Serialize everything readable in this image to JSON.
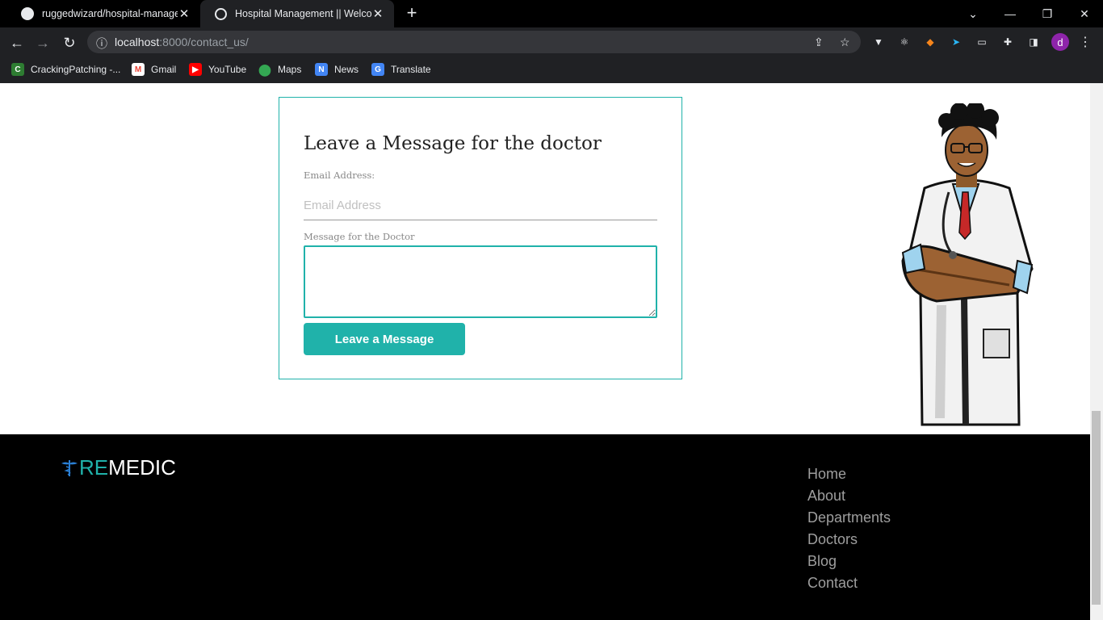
{
  "browser": {
    "tabs": [
      {
        "title": "ruggedwizard/hospital-managem",
        "close": "✕"
      },
      {
        "title": "Hospital Management || Welcom",
        "close": "✕"
      }
    ],
    "new_tab": "+",
    "url": {
      "host": "localhost",
      "path": ":8000/contact_us/"
    },
    "profile_initial": "d",
    "bookmarks": [
      {
        "label": "CrackingPatching -...",
        "icon": "crackingpatching-icon",
        "color": "#2e7d32"
      },
      {
        "label": "Gmail",
        "icon": "gmail-icon",
        "color": "#ea4335"
      },
      {
        "label": "YouTube",
        "icon": "youtube-icon",
        "color": "#ff0000"
      },
      {
        "label": "Maps",
        "icon": "maps-icon",
        "color": "#34a853"
      },
      {
        "label": "News",
        "icon": "news-icon",
        "color": "#4285f4"
      },
      {
        "label": "Translate",
        "icon": "translate-icon",
        "color": "#4285f4"
      }
    ]
  },
  "contact_form": {
    "title": "Leave a Message for the doctor",
    "email_label": "Email Address:",
    "email_value": "",
    "email_placeholder": "Email Address",
    "message_label": "Message for the Doctor",
    "message_value": "",
    "submit_label": "Leave a Message",
    "accent_color": "#20b2aa"
  },
  "footer": {
    "logo_re": "RE",
    "logo_medic": "MEDIC",
    "links": [
      "Home",
      "About",
      "Departments",
      "Doctors",
      "Blog",
      "Contact"
    ]
  }
}
